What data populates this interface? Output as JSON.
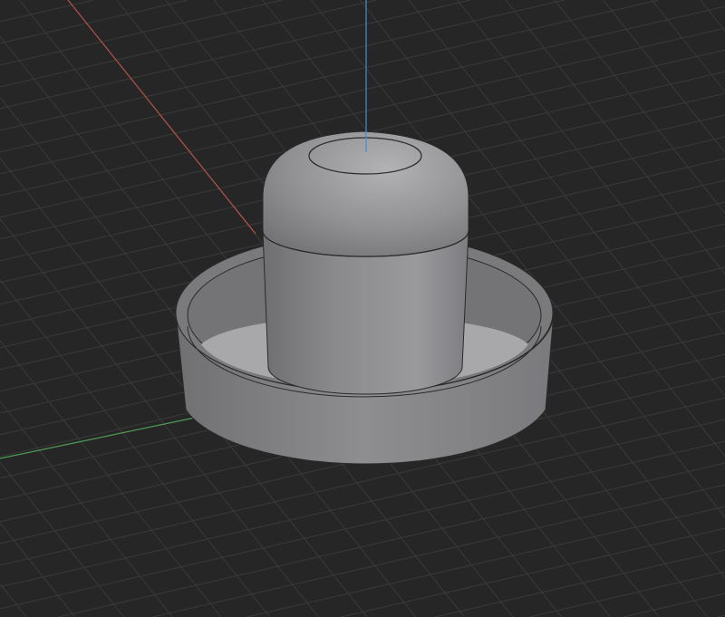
{
  "viewport": {
    "background_color": "#262626",
    "grid_color": "#3a3a3a",
    "axis_colors": {
      "x": "#b5524a",
      "y": "#4f9a55",
      "z": "#3d8fd1"
    },
    "model_color": "#8c8c8e"
  }
}
